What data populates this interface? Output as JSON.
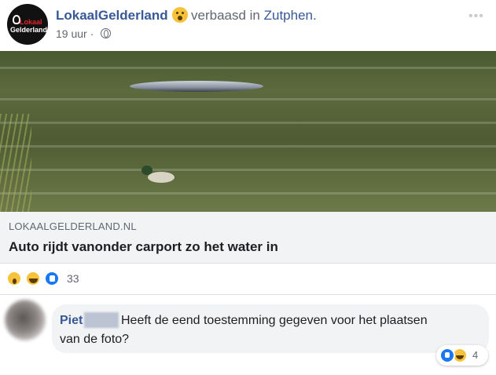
{
  "post": {
    "page_name": "LokaalGelderland",
    "avatar_text_line1": "Lokaal",
    "avatar_text_line2": "Gelderland",
    "feeling_icon": "astonished-emoji-icon",
    "feeling_prefix": "verbaasd in ",
    "location": "Zutphen.",
    "timestamp": "19 uur",
    "separator": "·",
    "privacy_icon": "globe-icon",
    "more_icon": "more-icon"
  },
  "link": {
    "image_description_icon": "link-photo",
    "domain": "LOKAALGELDERLAND.NL",
    "title": "Auto rijdt vanonder carport zo het water in"
  },
  "reactions": {
    "icons": [
      "wow-icon",
      "haha-icon",
      "like-icon"
    ],
    "count": "33"
  },
  "comment": {
    "author": "Piet",
    "text_line1": "Heeft de eend toestemming gegeven voor het plaatsen",
    "text_line2": "van de foto?",
    "reactions_icons": [
      "like-icon",
      "haha-icon"
    ],
    "reactions_count": "4"
  },
  "colors": {
    "link_blue": "#385898",
    "secondary_text": "#606770",
    "bubble_bg": "#f2f3f5",
    "like_blue": "#1877f2",
    "emoji_yellow": "#f7c23b"
  }
}
